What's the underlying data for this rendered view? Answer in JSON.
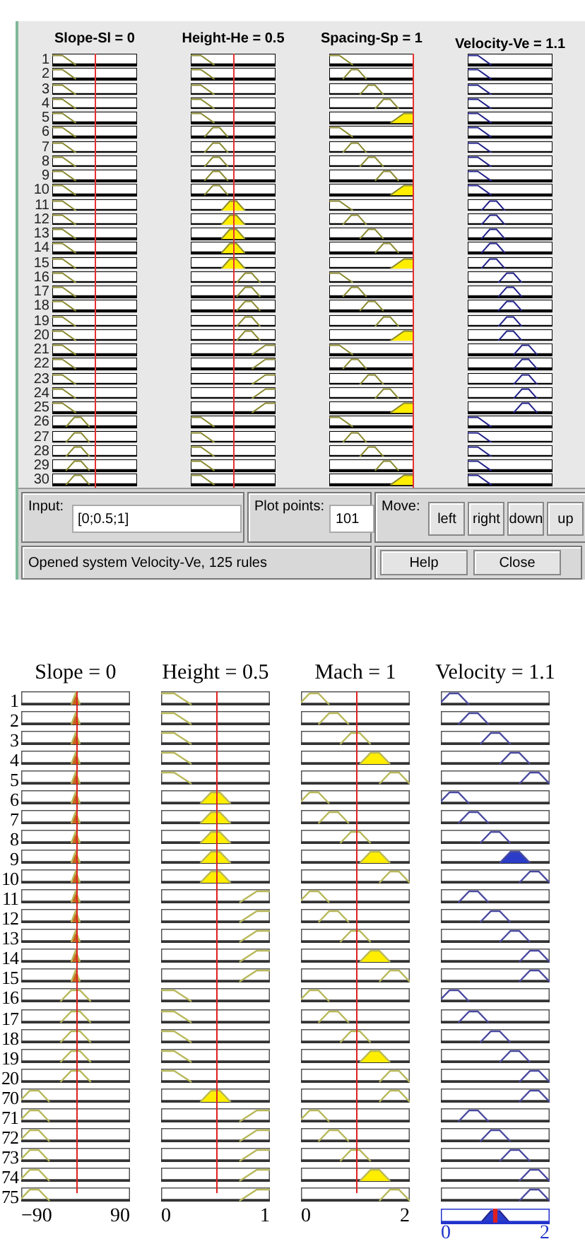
{
  "top": {
    "columns": [
      {
        "title": "Slope-Sl = 0",
        "kind": "input",
        "input_line": {
          "kind": "center"
        }
      },
      {
        "title": "Height-He = 0.5",
        "kind": "input",
        "input_line": {
          "kind": "center"
        }
      },
      {
        "title": "Spacing-Sp = 1",
        "kind": "input",
        "input_line": {
          "kind": "right"
        }
      },
      {
        "title": "Velocity-Ve = 1.1",
        "kind": "output"
      }
    ],
    "rows": [
      {
        "label": "1",
        "cells": [
          {
            "kind": "zshape",
            "fired": false
          },
          {
            "kind": "zshape",
            "fired": false
          },
          {
            "kind": "zshape",
            "fired": false
          },
          {
            "kind": "zshape",
            "fired": false
          }
        ]
      },
      {
        "label": "2",
        "cells": [
          {
            "kind": "zshape",
            "fired": false
          },
          {
            "kind": "zshape",
            "fired": false
          },
          {
            "kind": "lowmid",
            "fired": false
          },
          {
            "kind": "zshape",
            "fired": false
          }
        ]
      },
      {
        "label": "3",
        "cells": [
          {
            "kind": "zshape",
            "fired": false
          },
          {
            "kind": "zshape",
            "fired": false
          },
          {
            "kind": "mid",
            "fired": false
          },
          {
            "kind": "zshape",
            "fired": false
          }
        ]
      },
      {
        "label": "4",
        "cells": [
          {
            "kind": "zshape",
            "fired": false
          },
          {
            "kind": "zshape",
            "fired": false
          },
          {
            "kind": "highmid",
            "fired": false
          },
          {
            "kind": "zshape",
            "fired": false
          }
        ]
      },
      {
        "label": "5",
        "cells": [
          {
            "kind": "zshape",
            "fired": false
          },
          {
            "kind": "zshape",
            "fired": false
          },
          {
            "kind": "sshape",
            "fired": true
          },
          {
            "kind": "zshape",
            "fired": false
          }
        ]
      },
      {
        "label": "6",
        "cells": [
          {
            "kind": "zshape",
            "fired": false
          },
          {
            "kind": "lowmid",
            "fired": false
          },
          {
            "kind": "zshape",
            "fired": false
          },
          {
            "kind": "zshape",
            "fired": false
          }
        ]
      },
      {
        "label": "7",
        "cells": [
          {
            "kind": "zshape",
            "fired": false
          },
          {
            "kind": "lowmid",
            "fired": false
          },
          {
            "kind": "lowmid",
            "fired": false
          },
          {
            "kind": "zshape",
            "fired": false
          }
        ]
      },
      {
        "label": "8",
        "cells": [
          {
            "kind": "zshape",
            "fired": false
          },
          {
            "kind": "lowmid",
            "fired": false
          },
          {
            "kind": "mid",
            "fired": false
          },
          {
            "kind": "zshape",
            "fired": false
          }
        ]
      },
      {
        "label": "9",
        "cells": [
          {
            "kind": "zshape",
            "fired": false
          },
          {
            "kind": "lowmid",
            "fired": false
          },
          {
            "kind": "highmid",
            "fired": false
          },
          {
            "kind": "zshape",
            "fired": false
          }
        ]
      },
      {
        "label": "10",
        "cells": [
          {
            "kind": "zshape",
            "fired": false
          },
          {
            "kind": "lowmid",
            "fired": false
          },
          {
            "kind": "sshape",
            "fired": true
          },
          {
            "kind": "zshape",
            "fired": false
          }
        ]
      },
      {
        "label": "11",
        "cells": [
          {
            "kind": "zshape",
            "fired": false
          },
          {
            "kind": "mid",
            "fired": true
          },
          {
            "kind": "zshape",
            "fired": false
          },
          {
            "kind": "lowmid",
            "fired": false
          }
        ]
      },
      {
        "label": "12",
        "cells": [
          {
            "kind": "zshape",
            "fired": false
          },
          {
            "kind": "mid",
            "fired": true
          },
          {
            "kind": "lowmid",
            "fired": false
          },
          {
            "kind": "lowmid",
            "fired": false
          }
        ]
      },
      {
        "label": "13",
        "cells": [
          {
            "kind": "zshape",
            "fired": false
          },
          {
            "kind": "mid",
            "fired": true
          },
          {
            "kind": "mid",
            "fired": false
          },
          {
            "kind": "lowmid",
            "fired": false
          }
        ]
      },
      {
        "label": "14",
        "cells": [
          {
            "kind": "zshape",
            "fired": false
          },
          {
            "kind": "mid",
            "fired": true
          },
          {
            "kind": "highmid",
            "fired": false
          },
          {
            "kind": "lowmid",
            "fired": false
          }
        ]
      },
      {
        "label": "15",
        "cells": [
          {
            "kind": "zshape",
            "fired": false
          },
          {
            "kind": "mid",
            "fired": true
          },
          {
            "kind": "sshape",
            "fired": true
          },
          {
            "kind": "lowmid",
            "fired": false
          }
        ]
      },
      {
        "label": "16",
        "cells": [
          {
            "kind": "zshape",
            "fired": false
          },
          {
            "kind": "highmid",
            "fired": false
          },
          {
            "kind": "zshape",
            "fired": false
          },
          {
            "kind": "mid",
            "fired": false
          }
        ]
      },
      {
        "label": "17",
        "cells": [
          {
            "kind": "zshape",
            "fired": false
          },
          {
            "kind": "highmid",
            "fired": false
          },
          {
            "kind": "lowmid",
            "fired": false
          },
          {
            "kind": "mid",
            "fired": false
          }
        ]
      },
      {
        "label": "18",
        "cells": [
          {
            "kind": "zshape",
            "fired": false
          },
          {
            "kind": "highmid",
            "fired": false
          },
          {
            "kind": "mid",
            "fired": false
          },
          {
            "kind": "mid",
            "fired": false
          }
        ]
      },
      {
        "label": "19",
        "cells": [
          {
            "kind": "zshape",
            "fired": false
          },
          {
            "kind": "highmid",
            "fired": false
          },
          {
            "kind": "highmid",
            "fired": false
          },
          {
            "kind": "mid",
            "fired": false
          }
        ]
      },
      {
        "label": "20",
        "cells": [
          {
            "kind": "zshape",
            "fired": false
          },
          {
            "kind": "highmid",
            "fired": false
          },
          {
            "kind": "sshape",
            "fired": true
          },
          {
            "kind": "mid",
            "fired": false
          }
        ]
      },
      {
        "label": "21",
        "cells": [
          {
            "kind": "zshape",
            "fired": false
          },
          {
            "kind": "sshape",
            "fired": false
          },
          {
            "kind": "zshape",
            "fired": false
          },
          {
            "kind": "highmid",
            "fired": false
          }
        ]
      },
      {
        "label": "22",
        "cells": [
          {
            "kind": "zshape",
            "fired": false
          },
          {
            "kind": "sshape",
            "fired": false
          },
          {
            "kind": "lowmid",
            "fired": false
          },
          {
            "kind": "highmid",
            "fired": false
          }
        ]
      },
      {
        "label": "23",
        "cells": [
          {
            "kind": "zshape",
            "fired": false
          },
          {
            "kind": "sshape",
            "fired": false
          },
          {
            "kind": "mid",
            "fired": false
          },
          {
            "kind": "highmid",
            "fired": false
          }
        ]
      },
      {
        "label": "24",
        "cells": [
          {
            "kind": "zshape",
            "fired": false
          },
          {
            "kind": "sshape",
            "fired": false
          },
          {
            "kind": "highmid",
            "fired": false
          },
          {
            "kind": "highmid",
            "fired": false
          }
        ]
      },
      {
        "label": "25",
        "cells": [
          {
            "kind": "zshape",
            "fired": false
          },
          {
            "kind": "sshape",
            "fired": false
          },
          {
            "kind": "sshape",
            "fired": true
          },
          {
            "kind": "highmid",
            "fired": false
          }
        ]
      },
      {
        "label": "26",
        "cells": [
          {
            "kind": "lowmid",
            "fired": false
          },
          {
            "kind": "zshape",
            "fired": false
          },
          {
            "kind": "zshape",
            "fired": false
          },
          {
            "kind": "zshape",
            "fired": false
          }
        ]
      },
      {
        "label": "27",
        "cells": [
          {
            "kind": "lowmid",
            "fired": false
          },
          {
            "kind": "zshape",
            "fired": false
          },
          {
            "kind": "lowmid",
            "fired": false
          },
          {
            "kind": "zshape",
            "fired": false
          }
        ]
      },
      {
        "label": "28",
        "cells": [
          {
            "kind": "lowmid",
            "fired": false
          },
          {
            "kind": "zshape",
            "fired": false
          },
          {
            "kind": "mid",
            "fired": false
          },
          {
            "kind": "zshape",
            "fired": false
          }
        ]
      },
      {
        "label": "29",
        "cells": [
          {
            "kind": "lowmid",
            "fired": false
          },
          {
            "kind": "zshape",
            "fired": false
          },
          {
            "kind": "highmid",
            "fired": false
          },
          {
            "kind": "zshape",
            "fired": false
          }
        ]
      },
      {
        "label": "30",
        "cells": [
          {
            "kind": "lowmid",
            "fired": false
          },
          {
            "kind": "zshape",
            "fired": false
          },
          {
            "kind": "sshape",
            "fired": true
          },
          {
            "kind": "zshape",
            "fired": false
          }
        ]
      }
    ],
    "controls": {
      "input": {
        "label": "Input:",
        "value": "[0;0.5;1]"
      },
      "plot_points": {
        "label": "Plot points:",
        "value": "101"
      },
      "move": {
        "label": "Move:",
        "buttons": [
          "left",
          "right",
          "down",
          "up"
        ]
      },
      "status": "Opened system Velocity-Ve, 125 rules",
      "buttons": [
        "Help",
        "Close"
      ]
    }
  },
  "bottom": {
    "columns": [
      {
        "title": "Slope = 0",
        "kind": "input",
        "input_line": {
          "kind": "center"
        },
        "axis": [
          "−90",
          "90"
        ]
      },
      {
        "title": "Height = 0.5",
        "kind": "input",
        "input_line": {
          "kind": "center"
        },
        "axis": [
          "0",
          "1"
        ]
      },
      {
        "title": "Mach = 1",
        "kind": "input",
        "input_line": {
          "kind": "center"
        },
        "axis": [
          "0",
          "2"
        ]
      },
      {
        "title": "Velocity = 1.1",
        "kind": "output",
        "axis": [
          "0",
          "2"
        ],
        "output_plot": {
          "kind": "mid",
          "fired": true
        }
      }
    ],
    "rows": [
      {
        "label": "1",
        "cells": [
          {
            "kind": "spike",
            "fired": true
          },
          {
            "kind": "zshape",
            "fired": false
          },
          {
            "kind": "low",
            "fired": false
          },
          {
            "kind": "low",
            "fired": false
          }
        ]
      },
      {
        "label": "2",
        "cells": [
          {
            "kind": "spike",
            "fired": true
          },
          {
            "kind": "zshape",
            "fired": false
          },
          {
            "kind": "lowmid",
            "fired": false
          },
          {
            "kind": "lowmid",
            "fired": false
          }
        ]
      },
      {
        "label": "3",
        "cells": [
          {
            "kind": "spike",
            "fired": true
          },
          {
            "kind": "zshape",
            "fired": false
          },
          {
            "kind": "mid",
            "fired": false
          },
          {
            "kind": "mid",
            "fired": false
          }
        ]
      },
      {
        "label": "4",
        "cells": [
          {
            "kind": "spike",
            "fired": true
          },
          {
            "kind": "zshape",
            "fired": false
          },
          {
            "kind": "highmid",
            "fired": true
          },
          {
            "kind": "highmid",
            "fired": false
          }
        ]
      },
      {
        "label": "5",
        "cells": [
          {
            "kind": "spike",
            "fired": true
          },
          {
            "kind": "zshape",
            "fired": false
          },
          {
            "kind": "high",
            "fired": false
          },
          {
            "kind": "high",
            "fired": false
          }
        ]
      },
      {
        "label": "6",
        "cells": [
          {
            "kind": "spike",
            "fired": true
          },
          {
            "kind": "mid",
            "fired": true
          },
          {
            "kind": "low",
            "fired": false
          },
          {
            "kind": "low",
            "fired": false
          }
        ]
      },
      {
        "label": "7",
        "cells": [
          {
            "kind": "spike",
            "fired": true
          },
          {
            "kind": "mid",
            "fired": true
          },
          {
            "kind": "lowmid",
            "fired": false
          },
          {
            "kind": "lowmid",
            "fired": false
          }
        ]
      },
      {
        "label": "8",
        "cells": [
          {
            "kind": "spike",
            "fired": true
          },
          {
            "kind": "mid",
            "fired": true
          },
          {
            "kind": "mid",
            "fired": false
          },
          {
            "kind": "mid",
            "fired": false
          }
        ]
      },
      {
        "label": "9",
        "cells": [
          {
            "kind": "spike",
            "fired": true
          },
          {
            "kind": "mid",
            "fired": true
          },
          {
            "kind": "highmid",
            "fired": true
          },
          {
            "kind": "highmid",
            "fired": true
          }
        ]
      },
      {
        "label": "10",
        "cells": [
          {
            "kind": "spike",
            "fired": true
          },
          {
            "kind": "mid",
            "fired": true
          },
          {
            "kind": "high",
            "fired": false
          },
          {
            "kind": "high",
            "fired": false
          }
        ]
      },
      {
        "label": "11",
        "cells": [
          {
            "kind": "spike",
            "fired": true
          },
          {
            "kind": "sshape",
            "fired": false
          },
          {
            "kind": "low",
            "fired": false
          },
          {
            "kind": "lowmid",
            "fired": false
          }
        ]
      },
      {
        "label": "12",
        "cells": [
          {
            "kind": "spike",
            "fired": true
          },
          {
            "kind": "sshape",
            "fired": false
          },
          {
            "kind": "lowmid",
            "fired": false
          },
          {
            "kind": "mid",
            "fired": false
          }
        ]
      },
      {
        "label": "13",
        "cells": [
          {
            "kind": "spike",
            "fired": true
          },
          {
            "kind": "sshape",
            "fired": false
          },
          {
            "kind": "mid",
            "fired": false
          },
          {
            "kind": "highmid",
            "fired": false
          }
        ]
      },
      {
        "label": "14",
        "cells": [
          {
            "kind": "spike",
            "fired": true
          },
          {
            "kind": "sshape",
            "fired": false
          },
          {
            "kind": "highmid",
            "fired": true
          },
          {
            "kind": "high",
            "fired": false
          }
        ]
      },
      {
        "label": "15",
        "cells": [
          {
            "kind": "spike",
            "fired": true
          },
          {
            "kind": "sshape",
            "fired": false
          },
          {
            "kind": "high",
            "fired": false
          },
          {
            "kind": "high",
            "fired": false
          }
        ]
      },
      {
        "label": "16",
        "cells": [
          {
            "kind": "mid",
            "fired": false
          },
          {
            "kind": "zshape",
            "fired": false
          },
          {
            "kind": "low",
            "fired": false
          },
          {
            "kind": "low",
            "fired": false
          }
        ]
      },
      {
        "label": "17",
        "cells": [
          {
            "kind": "mid",
            "fired": false
          },
          {
            "kind": "zshape",
            "fired": false
          },
          {
            "kind": "lowmid",
            "fired": false
          },
          {
            "kind": "lowmid",
            "fired": false
          }
        ]
      },
      {
        "label": "18",
        "cells": [
          {
            "kind": "mid",
            "fired": false
          },
          {
            "kind": "zshape",
            "fired": false
          },
          {
            "kind": "mid",
            "fired": false
          },
          {
            "kind": "mid",
            "fired": false
          }
        ]
      },
      {
        "label": "19",
        "cells": [
          {
            "kind": "mid",
            "fired": false
          },
          {
            "kind": "zshape",
            "fired": false
          },
          {
            "kind": "highmid",
            "fired": true
          },
          {
            "kind": "highmid",
            "fired": false
          }
        ]
      },
      {
        "label": "20",
        "cells": [
          {
            "kind": "mid",
            "fired": false
          },
          {
            "kind": "zshape",
            "fired": false
          },
          {
            "kind": "high",
            "fired": false
          },
          {
            "kind": "high",
            "fired": false
          }
        ]
      },
      {
        "label": "70",
        "cells": [
          {
            "kind": "low",
            "fired": false
          },
          {
            "kind": "mid",
            "fired": true
          },
          {
            "kind": "high",
            "fired": false
          },
          {
            "kind": "high",
            "fired": false
          }
        ]
      },
      {
        "label": "71",
        "cells": [
          {
            "kind": "low",
            "fired": false
          },
          {
            "kind": "sshape",
            "fired": false
          },
          {
            "kind": "low",
            "fired": false
          },
          {
            "kind": "lowmid",
            "fired": false
          }
        ]
      },
      {
        "label": "72",
        "cells": [
          {
            "kind": "low",
            "fired": false
          },
          {
            "kind": "sshape",
            "fired": false
          },
          {
            "kind": "lowmid",
            "fired": false
          },
          {
            "kind": "mid",
            "fired": false
          }
        ]
      },
      {
        "label": "73",
        "cells": [
          {
            "kind": "low",
            "fired": false
          },
          {
            "kind": "sshape",
            "fired": false
          },
          {
            "kind": "mid",
            "fired": false
          },
          {
            "kind": "highmid",
            "fired": false
          }
        ]
      },
      {
        "label": "74",
        "cells": [
          {
            "kind": "low",
            "fired": false
          },
          {
            "kind": "sshape",
            "fired": false
          },
          {
            "kind": "highmid",
            "fired": true
          },
          {
            "kind": "high",
            "fired": false
          }
        ]
      },
      {
        "label": "75",
        "cells": [
          {
            "kind": "low",
            "fired": false
          },
          {
            "kind": "sshape",
            "fired": false
          },
          {
            "kind": "high",
            "fired": false
          },
          {
            "kind": "high",
            "fired": false
          }
        ]
      }
    ]
  }
}
